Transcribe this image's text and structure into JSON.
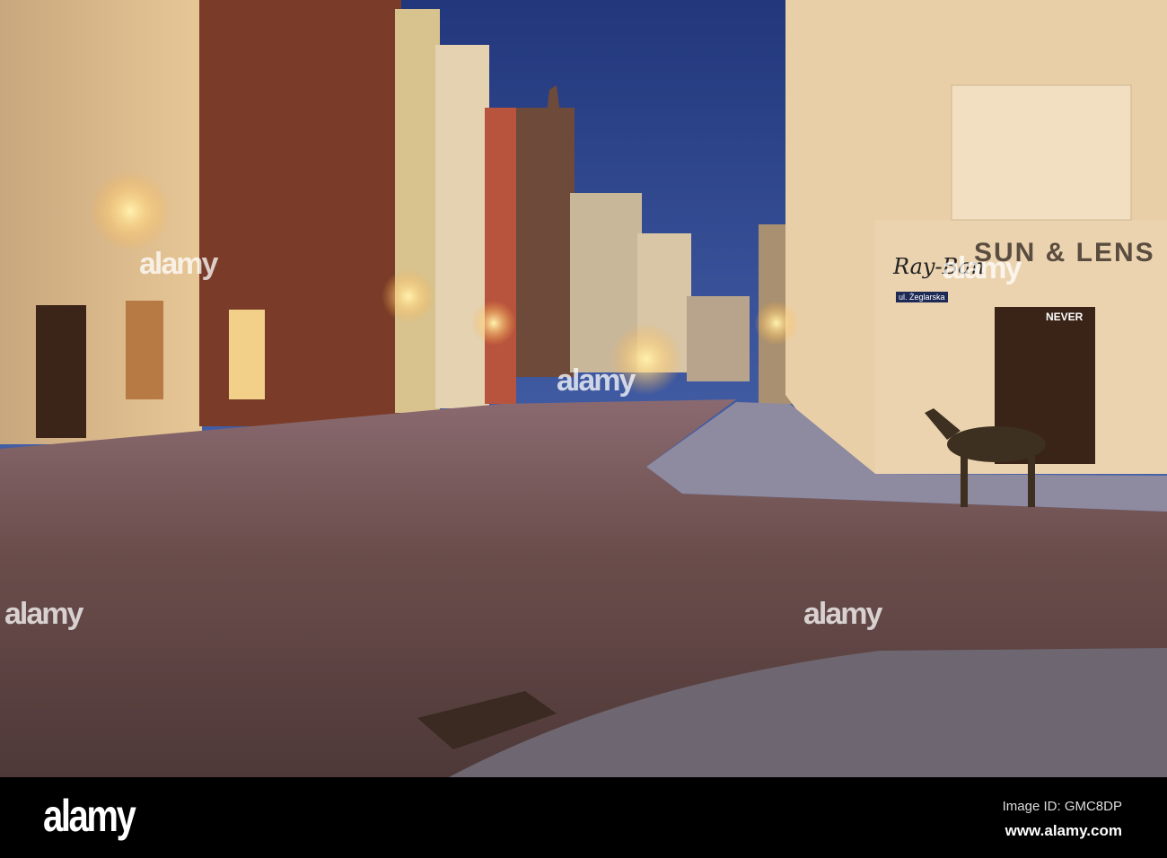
{
  "photo": {
    "subject": "street-scene",
    "shop_sign": {
      "brand": "Ray-Ban",
      "name": "SUN & LENS"
    },
    "street_sign": "ul. Żeglarska",
    "poster_text": "NEVER",
    "watermark": "alamy"
  },
  "footer": {
    "logo": "alamy",
    "image_id": "Image ID: GMC8DP",
    "website": "www.alamy.com"
  },
  "colors": {
    "sky": "#2b3f86",
    "wall": "#e9cfa8",
    "cobble": "#6a4f4a",
    "footer": "#000000"
  }
}
